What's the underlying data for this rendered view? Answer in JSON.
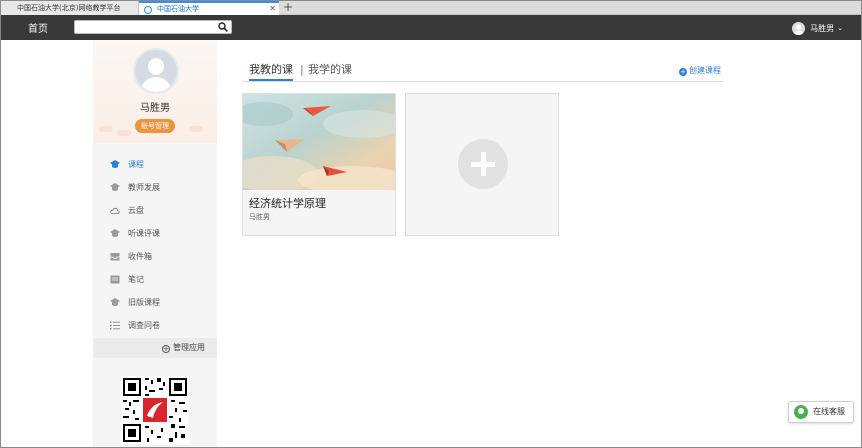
{
  "browser": {
    "tabs": [
      {
        "label": "中国石油大学(北京)网络教学平台"
      },
      {
        "label": "中国石油大学"
      }
    ],
    "close_glyph": "✕",
    "new_tab_glyph": "+"
  },
  "topnav": {
    "home_label": "首页",
    "search_placeholder": "",
    "search_value": "",
    "user_name": "马胜男",
    "caret": "⌄"
  },
  "sidebar": {
    "profile_name": "马胜男",
    "account_button": "账号管理",
    "menu": [
      {
        "label": "课程",
        "icon": "graduation-cap-icon",
        "active": true
      },
      {
        "label": "教师发展",
        "icon": "graduation-cap-icon"
      },
      {
        "label": "云盘",
        "icon": "cloud-icon"
      },
      {
        "label": "听课评课",
        "icon": "graduation-cap-icon"
      },
      {
        "label": "收件箱",
        "icon": "inbox-icon"
      },
      {
        "label": "笔记",
        "icon": "note-icon"
      },
      {
        "label": "旧版课程",
        "icon": "graduation-cap-icon"
      },
      {
        "label": "调查问卷",
        "icon": "list-icon"
      }
    ],
    "manage_apps": "管理应用"
  },
  "main": {
    "tabs": [
      {
        "label": "我教的课",
        "active": true
      },
      {
        "label": "我学的课"
      }
    ],
    "separator": "|",
    "create_course": "创建课程",
    "courses": [
      {
        "title": "经济统计学原理",
        "teacher": "马胜男"
      }
    ]
  },
  "service": {
    "label": "在线客服"
  },
  "colors": {
    "accent": "#2d7fd6",
    "topbar": "#393939",
    "account_button": "#f0933e"
  }
}
